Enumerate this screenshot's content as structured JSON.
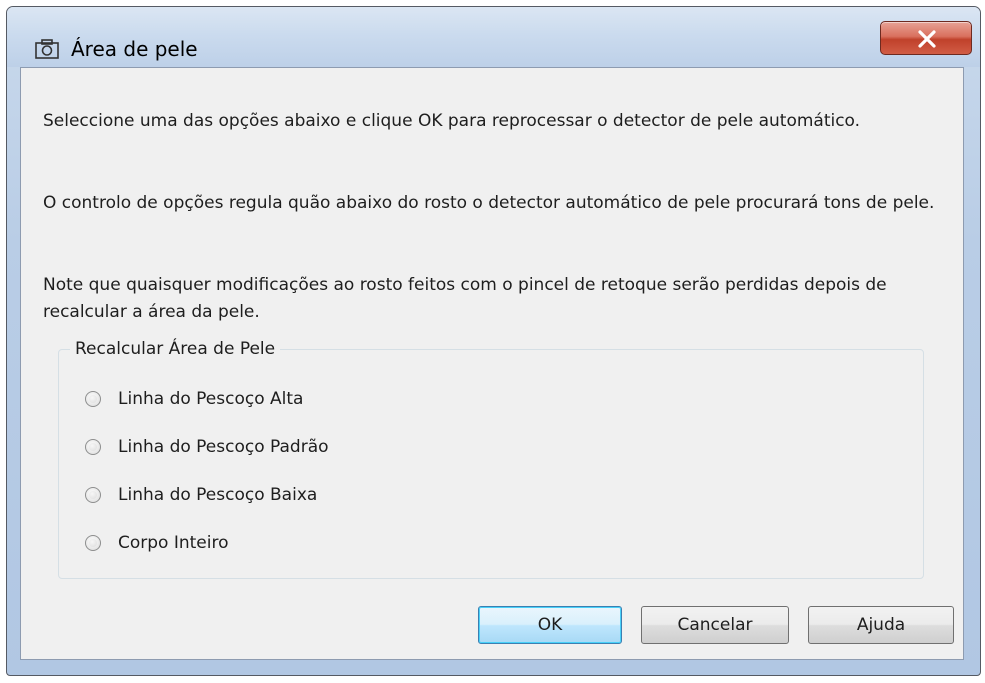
{
  "window": {
    "title": "Área de pele",
    "title_icon": "camera-icon",
    "close_icon": "close-icon"
  },
  "content": {
    "paragraphs": [
      "Seleccione uma das opções abaixo e clique OK para reprocessar o detector de pele automático.",
      "O controlo de opções regula quão abaixo do rosto o detector automático de pele procurará tons de pele.",
      "Note que quaisquer modificações ao rosto feitos com o pincel de retoque serão perdidas depois de recalcular a área da pele."
    ]
  },
  "group": {
    "title": "Recalcular Área de Pele",
    "options": [
      {
        "label": "Linha do Pescoço Alta",
        "selected": false
      },
      {
        "label": "Linha do Pescoço Padrão",
        "selected": false
      },
      {
        "label": "Linha do Pescoço Baixa",
        "selected": false
      },
      {
        "label": "Corpo Inteiro",
        "selected": false
      }
    ]
  },
  "buttons": {
    "ok": "OK",
    "cancel": "Cancelar",
    "help": "Ajuda"
  },
  "colors": {
    "default_button_border": "#3c7fb1",
    "close_button": "#c0412b",
    "titlebar": "#cbdbee"
  }
}
